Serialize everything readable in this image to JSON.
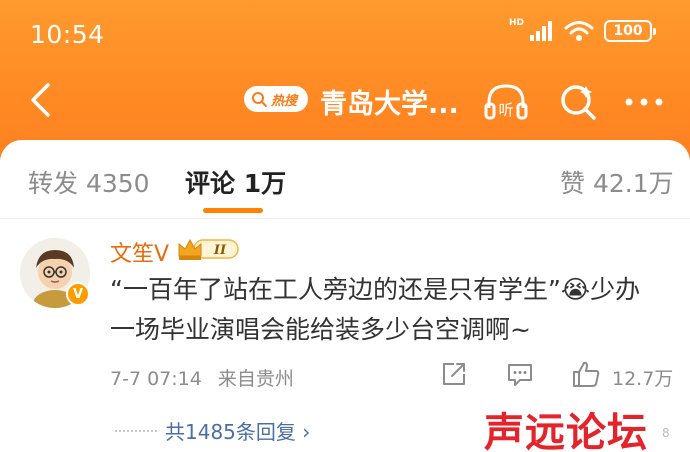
{
  "status_bar": {
    "time": "10:54",
    "hd_label": "HD",
    "battery": "100",
    "signal_icon": "signal-icon",
    "wifi_icon": "wifi-icon"
  },
  "nav": {
    "back_icon": "back-arrow-icon",
    "hot_badge": "热搜",
    "topic_title": "青岛大学...",
    "listen_label": "听",
    "search_icon": "search-icon",
    "more_icon": "more-icon"
  },
  "tabs": [
    {
      "label": "转发 4350"
    },
    {
      "label": "评论 1万"
    },
    {
      "label": "赞 42.1万"
    }
  ],
  "comment": {
    "username": "文笙V",
    "rank_badge": "II",
    "verified_badge": "V",
    "text_line1": "“一百年了站在工人旁边的还是只有学生”😭少办",
    "text_line2": "一场毕业演唱会能给装多少台空调啊~",
    "date": "7-7 07:14",
    "location": "来自贵州",
    "like_count": "12.7万",
    "replies": "共1485条回复 ›"
  },
  "watermark": {
    "text": "声远论坛",
    "suffix": "8"
  },
  "colors": {
    "header_orange": "#ff8a24",
    "accent": "#ff8200",
    "username": "#e86b0c",
    "link": "#4a6fa5",
    "watermark": "#e3242b"
  }
}
